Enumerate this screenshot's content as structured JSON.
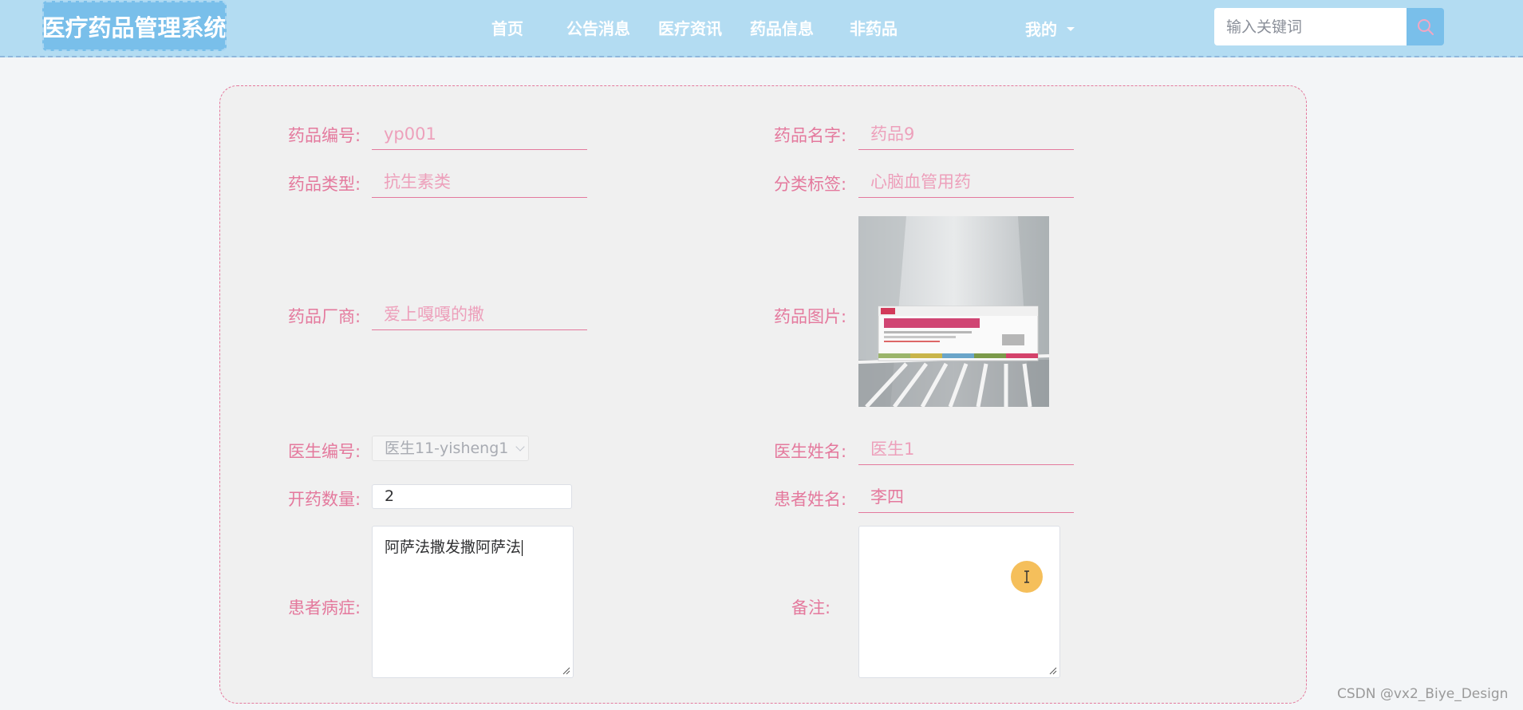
{
  "app": {
    "title": "医疗药品管理系统"
  },
  "nav": {
    "items": [
      {
        "label": "首页"
      },
      {
        "label": "公告消息"
      },
      {
        "label": "医疗资讯"
      },
      {
        "label": "药品信息"
      },
      {
        "label": "非药品"
      }
    ],
    "my_label": "我的",
    "search_placeholder": "输入关键词",
    "search_value": "",
    "search_icon": "search-icon"
  },
  "form": {
    "drug_code": {
      "label": "药品编号:",
      "value": "yp001"
    },
    "drug_name": {
      "label": "药品名字:",
      "value": "药品9"
    },
    "drug_type": {
      "label": "药品类型:",
      "value": "抗生素类"
    },
    "category_tag": {
      "label": "分类标签:",
      "value": "心脑血管用药"
    },
    "manufacturer": {
      "label": "药品厂商:",
      "value": "爱上嘎嘎的撒"
    },
    "drug_image": {
      "label": "药品图片:"
    },
    "doctor_id": {
      "label": "医生编号:",
      "selected": "医生11-yisheng1"
    },
    "doctor_name": {
      "label": "医生姓名:",
      "value": "医生1"
    },
    "quantity": {
      "label": "开药数量:",
      "value": "2"
    },
    "patient_name": {
      "label": "患者姓名:",
      "value": "李四"
    },
    "symptoms": {
      "label": "患者病症:",
      "value": "阿萨法撒发撒阿萨法"
    },
    "remarks": {
      "label": "备注:",
      "value": ""
    }
  },
  "watermark": "CSDN @vx2_Biye_Design",
  "colors": {
    "nav_bg": "#b3dcf2",
    "accent_blue": "#79bfea",
    "label_pink": "#e4799d",
    "cursor_yellow": "#f5bf5b"
  }
}
